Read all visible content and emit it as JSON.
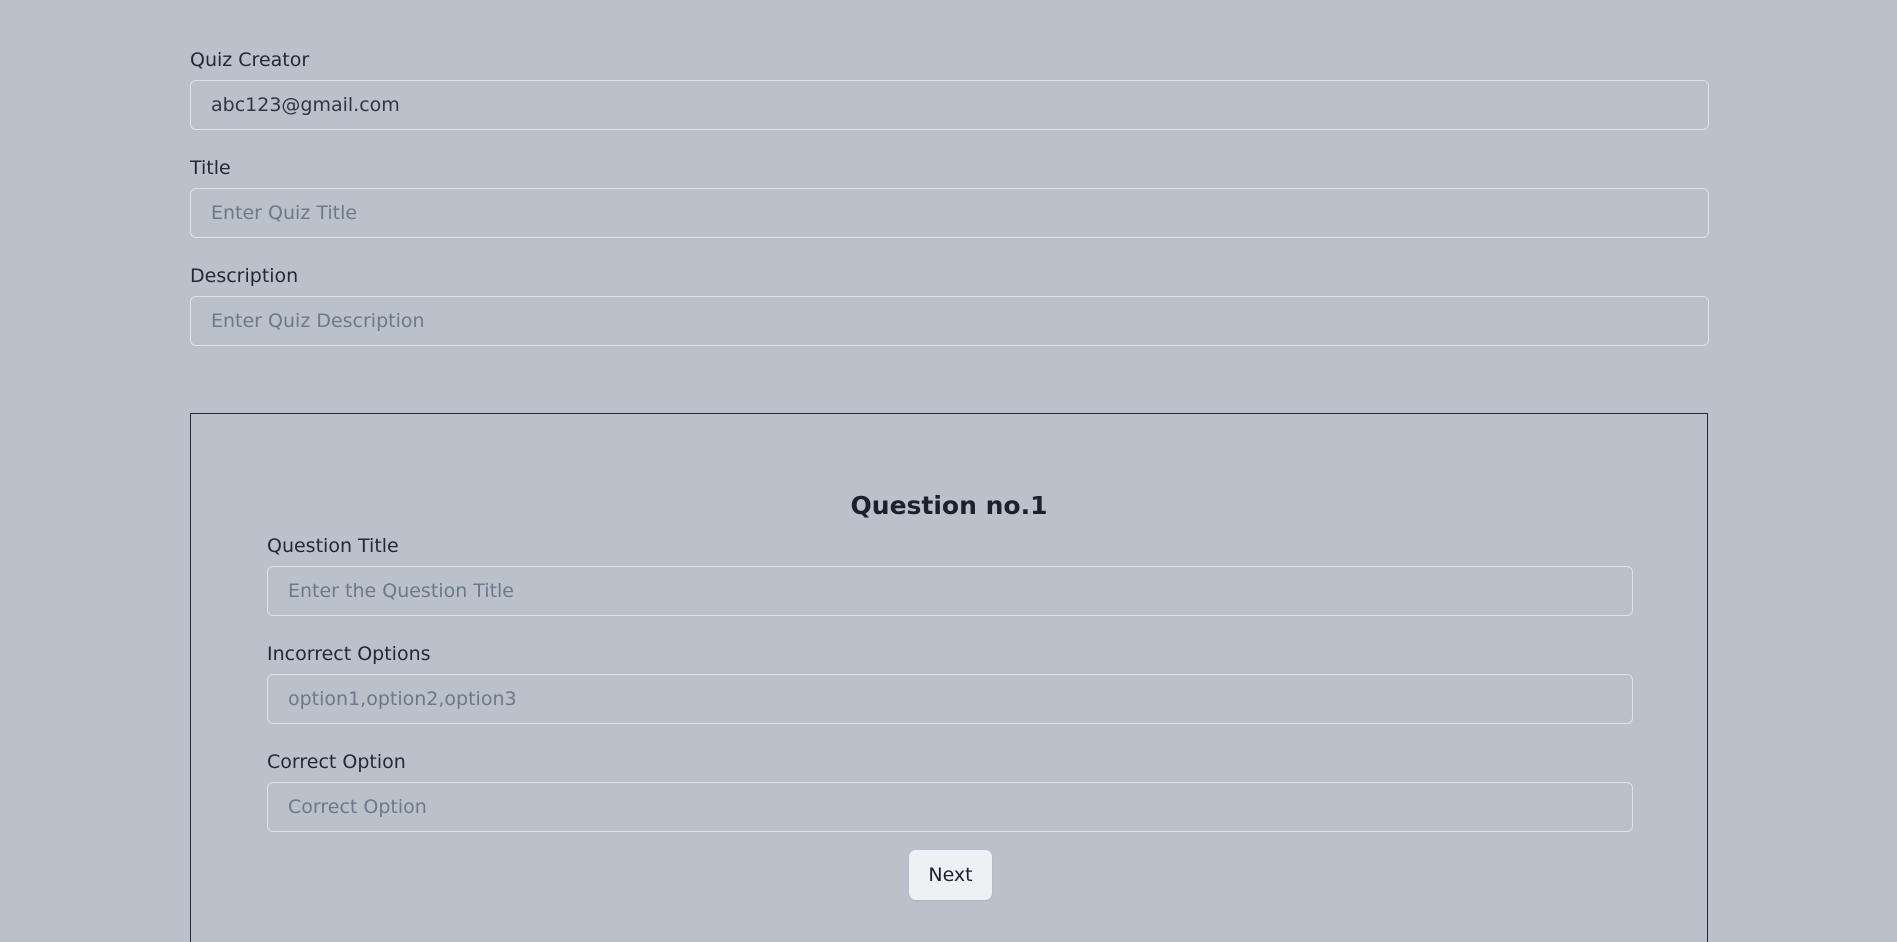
{
  "quiz": {
    "creator_label": "Quiz Creator",
    "creator_value": "abc123@gmail.com",
    "title_label": "Title",
    "title_placeholder": "Enter Quiz Title",
    "description_label": "Description",
    "description_placeholder": "Enter Quiz Description"
  },
  "question": {
    "heading": "Question no.1",
    "title_label": "Question Title",
    "title_placeholder": "Enter the Question Title",
    "incorrect_label": "Incorrect Options",
    "incorrect_placeholder": "option1,option2,option3",
    "correct_label": "Correct Option",
    "correct_placeholder": "Correct Option",
    "next_label": "Next"
  },
  "colors": {
    "background": "#bac1ca",
    "text": "#1f2937",
    "placeholder": "#6b7a8b",
    "button_bg": "#eef1f4",
    "panel_border": "#1f2937"
  }
}
